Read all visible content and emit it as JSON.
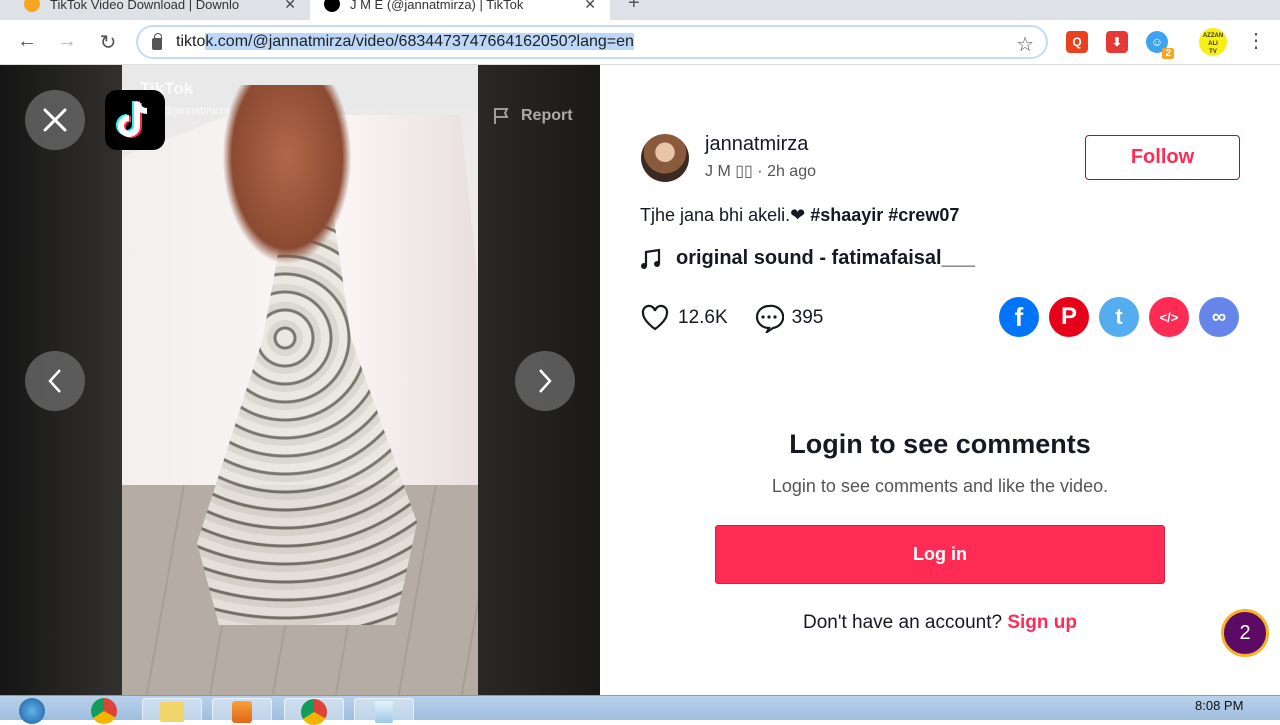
{
  "browser": {
    "tabs": [
      {
        "title": "TikTok Video Download | Downlo",
        "active": false,
        "favicon": "tiktok-download-favicon"
      },
      {
        "title": "J M E (@jannatmirza) | TikTok",
        "active": true,
        "favicon": "tiktok-favicon"
      }
    ],
    "new_tab_label": "+",
    "url_prefix": "tikto",
    "url_selected": "k.com/@jannatmirza/video/6834473747664162050?lang=en",
    "extensions": [
      {
        "name": "search-extension",
        "glyph": "Q",
        "color": "#e8411f"
      },
      {
        "name": "download-extension",
        "glyph": "⬇",
        "color": "#e53935"
      },
      {
        "name": "ghost-extension",
        "glyph": "☺",
        "color": "#3fa4ef",
        "badge": "2"
      }
    ],
    "profile_label_1": "AZZAN",
    "profile_label_2": "ALI",
    "profile_label_3": "TV"
  },
  "player": {
    "watermark": "TikTok",
    "watermark_user": "@jannatmirza",
    "report_label": "Report"
  },
  "post": {
    "username": "jannatmirza",
    "nickname": "J M",
    "time_ago": "2h ago",
    "follow_label": "Follow",
    "description_text": "Tjhe jana bhi akeli.",
    "description_heart": "❤",
    "hashtags": [
      "#shaayir",
      "#crew07"
    ],
    "sound": "original sound - fatimafaisal___",
    "likes": "12.6K",
    "comments": "395",
    "share_targets": [
      {
        "name": "facebook",
        "color": "#0075fa",
        "glyph": "f"
      },
      {
        "name": "pinterest",
        "color": "#e60019",
        "glyph": "P"
      },
      {
        "name": "twitter",
        "color": "#55acee",
        "glyph": "t"
      },
      {
        "name": "embed",
        "color": "#fe2c55",
        "glyph": "</>"
      },
      {
        "name": "copy-link",
        "color": "#6586e8",
        "glyph": "∞"
      }
    ]
  },
  "login": {
    "title": "Login to see comments",
    "subtitle": "Login to see comments and like the video.",
    "button": "Log in",
    "signup_prompt": "Don't have an account?",
    "signup_link": "Sign up"
  },
  "floating_badge": "2",
  "taskbar": {
    "clock": "8:08 PM"
  },
  "colors": {
    "brand": "#fe2c55",
    "text": "#161823"
  }
}
